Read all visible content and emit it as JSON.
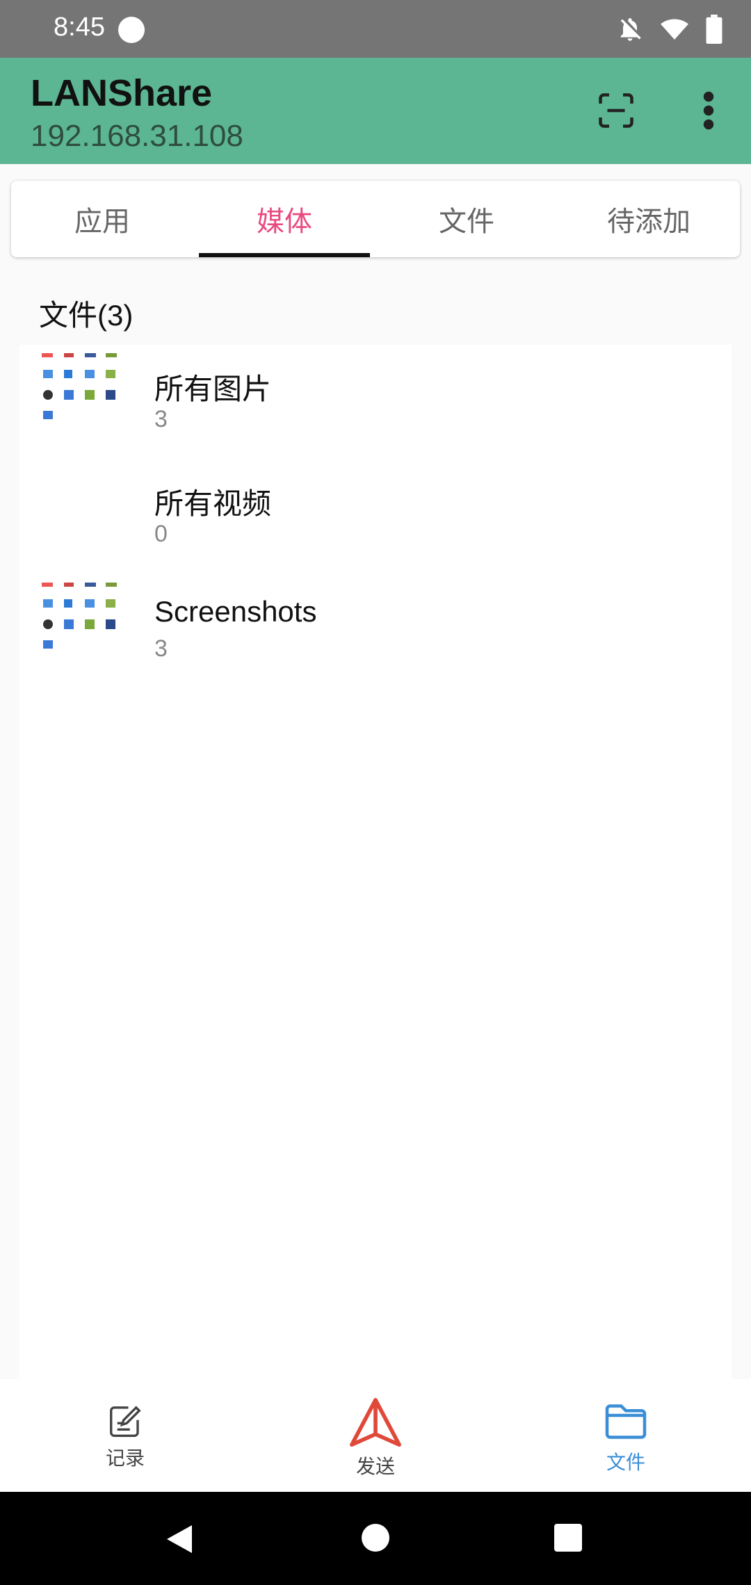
{
  "status_bar": {
    "time": "8:45",
    "icons": [
      "notifications-off-icon",
      "wifi-icon",
      "battery-icon"
    ]
  },
  "app_bar": {
    "title": "LANShare",
    "subtitle": "192.168.31.108",
    "actions": [
      "scan-icon",
      "more-vert-icon"
    ]
  },
  "tabs": [
    {
      "label": "应用",
      "active": false
    },
    {
      "label": "媒体",
      "active": true
    },
    {
      "label": "文件",
      "active": false
    },
    {
      "label": "待添加",
      "active": false
    }
  ],
  "section": {
    "title": "文件(3)"
  },
  "list": [
    {
      "title": "所有图片",
      "count": "3",
      "has_thumb": true
    },
    {
      "title": "所有视频",
      "count": "0",
      "has_thumb": false
    },
    {
      "title": "Screenshots",
      "count": "3",
      "has_thumb": true
    }
  ],
  "bottom_nav": [
    {
      "label": "记录",
      "icon": "note-edit-icon",
      "active": false
    },
    {
      "label": "发送",
      "icon": "send-triangle-icon",
      "active": false
    },
    {
      "label": "文件",
      "icon": "folder-icon",
      "active": true
    }
  ],
  "colors": {
    "status_bar": "#757575",
    "app_bar": "#5cb593",
    "tab_active": "#e94b80",
    "nav_active": "#3a8ed6",
    "send_icon": "#e0493a"
  }
}
